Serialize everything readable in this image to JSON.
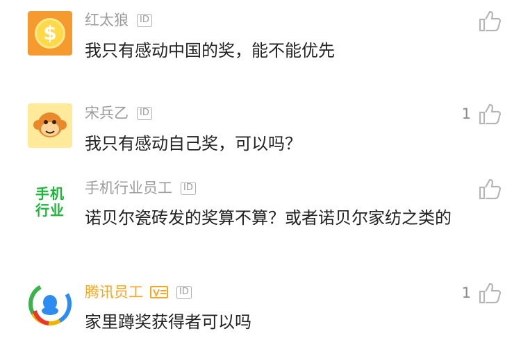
{
  "comments": [
    {
      "user": "红太狼",
      "id_badge": "ID",
      "text": "我只有感动中国的奖，能不能优先",
      "likes": ""
    },
    {
      "user": "宋兵乙",
      "id_badge": "ID",
      "text": "我只有感动自己奖，可以吗？",
      "likes": "1"
    },
    {
      "user": "手机行业员工",
      "id_badge": "ID",
      "text": "诺贝尔瓷砖发的奖算不算？或者诺贝尔家纺之类的",
      "likes": "",
      "avatar_text": [
        "手机",
        "行业"
      ]
    },
    {
      "user": "腾讯员工",
      "id_badge": "ID",
      "text": "家里蹲奖获得者可以吗",
      "likes": "1"
    }
  ],
  "colors": {
    "accent_gold": "#f5a623",
    "industry_green": "#1fb53b"
  }
}
